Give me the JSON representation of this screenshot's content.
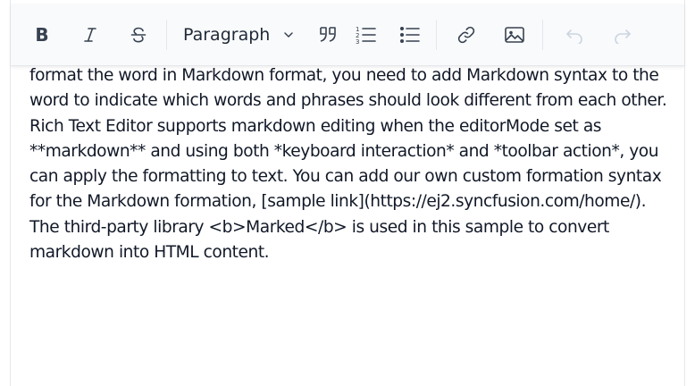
{
  "toolbar": {
    "bold": "B",
    "format_select": "Paragraph",
    "icons": [
      "bold-icon",
      "italic-icon",
      "strikethrough-icon",
      "chevron-down-icon",
      "blockquote-icon",
      "ordered-list-icon",
      "unordered-list-icon",
      "link-icon",
      "image-icon",
      "undo-icon",
      "redo-icon"
    ]
  },
  "content": {
    "text": "format the word in Markdown format, you need to add Markdown syntax to the word to indicate which words and phrases should look different from each other. Rich Text Editor supports markdown editing when the editorMode set as **markdown** and using both *keyboard interaction* and *toolbar action*, you can apply the formatting to text. You can add our own custom formation syntax for the Markdown formation, [sample link](https://ej2.syncfusion.com/home/). The third-party library <b>Marked</b> is used in this sample to convert markdown into HTML content."
  }
}
